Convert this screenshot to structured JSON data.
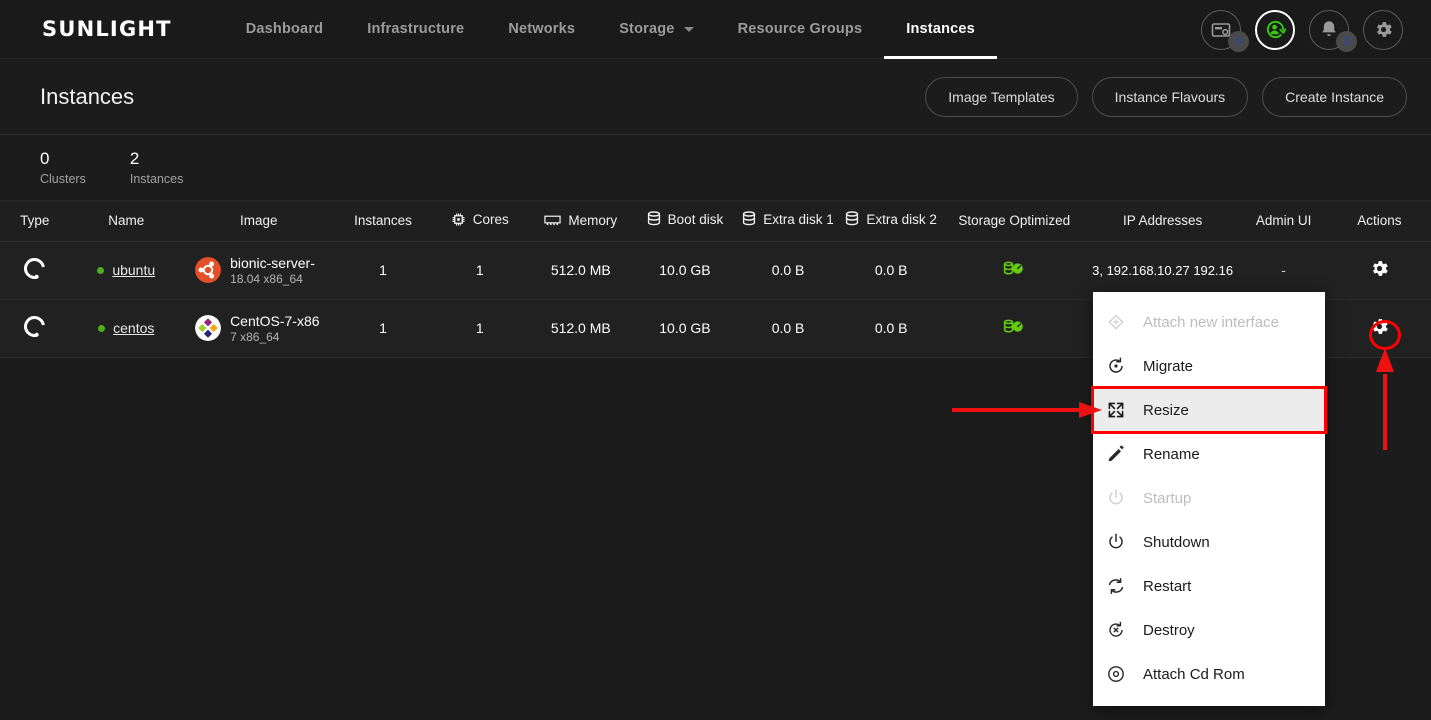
{
  "nav": {
    "brand": "SUNLIGHT",
    "items": [
      {
        "label": "Dashboard",
        "active": false,
        "caret": false
      },
      {
        "label": "Infrastructure",
        "active": false,
        "caret": false
      },
      {
        "label": "Networks",
        "active": false,
        "caret": false
      },
      {
        "label": "Storage",
        "active": false,
        "caret": true
      },
      {
        "label": "Resource Groups",
        "active": false,
        "caret": false
      },
      {
        "label": "Instances",
        "active": true,
        "caret": false
      }
    ],
    "right_icons": [
      {
        "name": "license-icon",
        "badge": "0"
      },
      {
        "name": "user-sync-icon",
        "badge": null
      },
      {
        "name": "bell-icon",
        "badge": "3"
      },
      {
        "name": "settings-gear-icon",
        "badge": null
      }
    ]
  },
  "header": {
    "title": "Instances",
    "buttons": [
      {
        "label": "Image Templates"
      },
      {
        "label": "Instance Flavours"
      },
      {
        "label": "Create Instance"
      }
    ]
  },
  "stats": [
    {
      "num": "0",
      "label": "Clusters"
    },
    {
      "num": "2",
      "label": "Instances"
    }
  ],
  "table": {
    "columns": [
      {
        "label": "Type",
        "icon": null
      },
      {
        "label": "Name",
        "icon": null
      },
      {
        "label": "Image",
        "icon": null
      },
      {
        "label": "Instances",
        "icon": null
      },
      {
        "label": "Cores",
        "icon": "cpu-icon"
      },
      {
        "label": "Memory",
        "icon": "memory-icon"
      },
      {
        "label": "Boot disk",
        "icon": "disk-icon"
      },
      {
        "label": "Extra disk 1",
        "icon": "disk-icon"
      },
      {
        "label": "Extra disk 2",
        "icon": "disk-icon"
      },
      {
        "label": "Storage Optimized",
        "icon": null
      },
      {
        "label": "IP Addresses",
        "icon": null
      },
      {
        "label": "Admin UI",
        "icon": null
      },
      {
        "label": "Actions",
        "icon": null
      }
    ],
    "rows": [
      {
        "type_icon": "spinner-icon",
        "status": "running",
        "name": "ubuntu",
        "image_name": "bionic-server-",
        "image_version": "18.04 x86_64",
        "image_logo": "ubuntu-logo",
        "instances": "1",
        "cores": "1",
        "memory": "512.0 MB",
        "boot_disk": "10.0 GB",
        "extra_disk_1": "0.0 B",
        "extra_disk_2": "0.0 B",
        "storage_optimized": "storage-optimized-icon",
        "ip_addresses": "3, 192.168.10.27 192.16",
        "admin_ui": "-",
        "actions": "gear-icon"
      },
      {
        "type_icon": "spinner-icon",
        "status": "running",
        "name": "centos",
        "image_name": "CentOS-7-x86",
        "image_version": "7 x86_64",
        "image_logo": "centos-logo",
        "instances": "1",
        "cores": "1",
        "memory": "512.0 MB",
        "boot_disk": "10.0 GB",
        "extra_disk_1": "0.0 B",
        "extra_disk_2": "0.0 B",
        "storage_optimized": "storage-optimized-icon",
        "ip_addresses": "",
        "admin_ui": "",
        "actions": "gear-icon"
      }
    ]
  },
  "context_menu": {
    "items": [
      {
        "label": "Attach new interface",
        "icon": "attach-interface-icon",
        "disabled": true,
        "highlighted": false
      },
      {
        "label": "Migrate",
        "icon": "migrate-icon",
        "disabled": false,
        "highlighted": false
      },
      {
        "label": "Resize",
        "icon": "resize-icon",
        "disabled": false,
        "highlighted": true
      },
      {
        "label": "Rename",
        "icon": "pencil-icon",
        "disabled": false,
        "highlighted": false
      },
      {
        "label": "Startup",
        "icon": "power-icon",
        "disabled": true,
        "highlighted": false
      },
      {
        "label": "Shutdown",
        "icon": "power-icon",
        "disabled": false,
        "highlighted": false
      },
      {
        "label": "Restart",
        "icon": "restart-icon",
        "disabled": false,
        "highlighted": false
      },
      {
        "label": "Destroy",
        "icon": "destroy-icon",
        "disabled": false,
        "highlighted": false
      },
      {
        "label": "Attach Cd Rom",
        "icon": "cdrom-icon",
        "disabled": false,
        "highlighted": false
      }
    ]
  },
  "annotations": {
    "color": "#ff0000",
    "horizontal_arrow": "points-right-to-resize-item",
    "vertical_arrow": "points-up-to-actions-gear",
    "circle": "highlights-actions-gear-row-2"
  }
}
